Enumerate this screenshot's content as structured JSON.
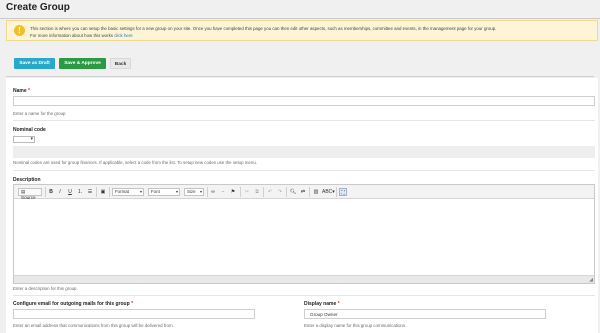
{
  "page": {
    "title": "Create Group"
  },
  "notice": {
    "line1": "This section is where you can setup the basic settings for a new group on your site. Once you have completed this page you can then edit other aspects, such as memberships, committee and events, in the management page for your group.",
    "line2_prefix": "For more information about how this works ",
    "line2_link": "click here"
  },
  "actions": {
    "save_draft": "Save as Draft",
    "save_approve": "Save & Approve",
    "back": "Back"
  },
  "form": {
    "name": {
      "label": "Name",
      "required": "*",
      "value": "",
      "help": "Enter a name for the group"
    },
    "nominal_code": {
      "label": "Nominal code",
      "selected": "",
      "help": "Nominal codes are used for group finances. If applicable, select a code from the list. To setup new codes use the setup menu."
    },
    "description": {
      "label": "Description",
      "help": "Enter a description for this group.",
      "toolbar": {
        "source": "Source",
        "bold": "B",
        "italic": "I",
        "underline": "U",
        "format": "Format",
        "font": "Font",
        "size": "Size"
      }
    },
    "email": {
      "label": "Configure email for outgoing mails for this group",
      "required": "*",
      "value": "",
      "help": "Enter an email address that communications from this group will be delivered from."
    },
    "display_name": {
      "label": "Display name",
      "required": "*",
      "value": "Group Owner",
      "help": "Enter a display name for this group communications."
    }
  },
  "colors": {
    "draft_button": "#2aa8c8",
    "approve_button": "#2c9a45",
    "required_marker": "#c0392b",
    "notice_background": "#fdf5d6",
    "notice_icon": "#f1bf2c"
  }
}
